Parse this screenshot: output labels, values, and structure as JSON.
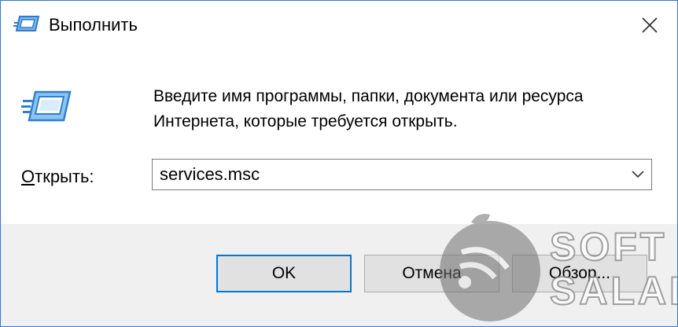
{
  "window": {
    "title": "Выполнить",
    "title_icon": "run-dialog-icon",
    "close_icon": "close-icon"
  },
  "description": "Введите имя программы, папки, документа или ресурса\nИнтернета, которые требуется открыть.",
  "open": {
    "label": "Открыть:",
    "value": "services.msc",
    "dropdown_icon": "chevron-down-icon"
  },
  "buttons": {
    "ok": "OK",
    "cancel": "Отмена",
    "browse": "Обзор..."
  },
  "watermark": {
    "line1": "SOFT",
    "line2": "SALAD"
  },
  "colors": {
    "window_border": "#2b79d6",
    "icon_blue": "#3a8fe0",
    "default_button_border": "#0078d7",
    "button_bar": "#f0f0f0"
  }
}
